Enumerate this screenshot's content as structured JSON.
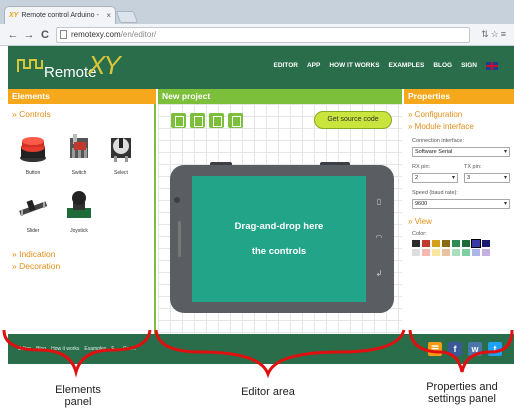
{
  "browser": {
    "tab_logo": "XY",
    "tab_title": "Remote control Arduino -",
    "tab_close": "×",
    "url_domain": "remotexy.com",
    "url_path": "/en/editor/",
    "back_icon": "←",
    "forward_icon": "→",
    "reload_icon": "C",
    "right_icons": "⇅☆≡"
  },
  "site": {
    "logo_text": "Remote",
    "logo_xy": "XY",
    "nav": [
      "EDITOR",
      "APP",
      "HOW IT WORKS",
      "EXAMPLES",
      "BLOG",
      "SIGN"
    ]
  },
  "elements_panel": {
    "header": "Elements",
    "controls_title": "» Controls",
    "controls": [
      "Button",
      "Switch",
      "Select",
      "Slider",
      "Joystick"
    ],
    "indication_title": "» Indication",
    "decoration_title": "» Decoration"
  },
  "editor": {
    "header": "New project",
    "get_source": "Get source code",
    "drop_line1": "Drag-and-drop here",
    "drop_line2": "the controls"
  },
  "properties": {
    "header": "Properties",
    "configuration": "» Configuration",
    "module_interface": "» Module interface",
    "connection_label": "Connection interface:",
    "connection_value": "Software Serial",
    "rx_label": "RX pin:",
    "rx_value": "2",
    "tx_label": "TX pin:",
    "tx_value": "3",
    "speed_label": "Speed (baud rate):",
    "speed_value": "9600",
    "view_title": "» View",
    "color_label": "Color:",
    "colors_row1": [
      "#2b2b2b",
      "#c0392b",
      "#d4a017",
      "#8b6914",
      "#2e8b57",
      "#1e6b3a",
      "#3a3aa8",
      "#1a1a6e"
    ],
    "colors_row2": [
      "#dddddd",
      "#f5b7b1",
      "#f9e79f",
      "#e8c39e",
      "#a9dfbf",
      "#7dcea0",
      "#aeb6e8",
      "#c5b0e6"
    ]
  },
  "footer": {
    "links": [
      "Editor",
      "Blog",
      "How it works",
      "Examples",
      "F...",
      "Con..."
    ],
    "social": [
      "☰",
      "f",
      "w",
      "t"
    ]
  },
  "annotations": {
    "elements_line1": "Elements",
    "elements_line2": "panel",
    "editor": "Editor area",
    "properties_line1": "Properties and",
    "properties_line2": "settings panel"
  }
}
